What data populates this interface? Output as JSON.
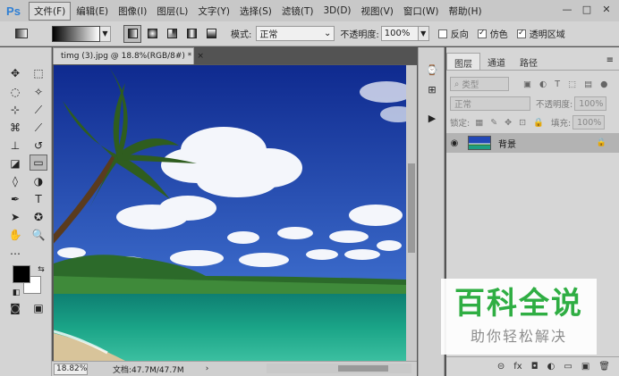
{
  "menubar": {
    "logo": "Ps",
    "items": [
      "文件(F)",
      "编辑(E)",
      "图像(I)",
      "图层(L)",
      "文字(Y)",
      "选择(S)",
      "滤镜(T)",
      "3D(D)",
      "视图(V)",
      "窗口(W)",
      "帮助(H)"
    ],
    "window_controls": [
      "—",
      "□",
      "✕"
    ]
  },
  "options": {
    "mode_label": "模式:",
    "mode_value": "正常",
    "opacity_label": "不透明度:",
    "opacity_value": "100%",
    "reverse_label": "反向",
    "dither_label": "仿色",
    "transparency_label": "透明区域"
  },
  "document": {
    "tab_title": "timg (3).jpg @ 18.8%(RGB/8#) *",
    "tab_close": "×",
    "zoom": "18.82%",
    "doc_info": "文档:47.7M/47.7M",
    "status_arrow": "›"
  },
  "layers_panel": {
    "tabs": [
      "图层",
      "通道",
      "路径"
    ],
    "menu_icon": "≡",
    "filter_placeholder": "类型",
    "blend_mode": "正常",
    "opacity_label": "不透明度:",
    "opacity_value": "100%",
    "lock_label": "锁定:",
    "fill_label": "填充:",
    "fill_value": "100%",
    "layer_name": "背景",
    "bottom_icons": [
      "⊝",
      "fx",
      "◘",
      "◐",
      "▭",
      "▣",
      "🗑"
    ]
  },
  "watermark": {
    "title": "百科全说",
    "subtitle": "助你轻松解决"
  },
  "colors": {
    "sky": "#1d3fa8",
    "sea": "#1a9a7c",
    "watermark_green": "#2fae43"
  }
}
